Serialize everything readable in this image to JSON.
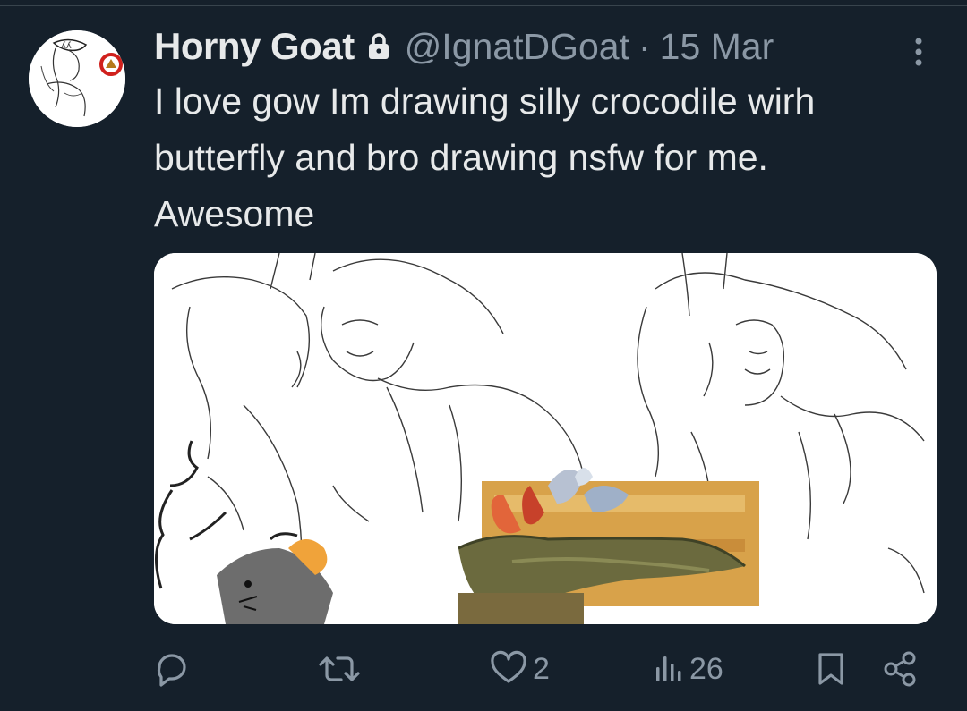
{
  "tweet": {
    "display_name": "Horny Goat",
    "handle": "@IgnatDGoat",
    "separator": "·",
    "date": "15 Mar",
    "text_lines": [
      "I love gow Im drawing silly crocodile wirh",
      "butterfly and bro drawing nsfw for me.",
      "Awesome"
    ],
    "protected_icon": "lock-icon",
    "media_description_icon": "image"
  },
  "actions": {
    "reply_count": "",
    "retweet_count": "",
    "like_count": "2",
    "views_count": "26"
  },
  "colors": {
    "background": "#15202b",
    "text": "#e7e9ea",
    "secondary": "#8b98a5",
    "border": "#38444d"
  }
}
